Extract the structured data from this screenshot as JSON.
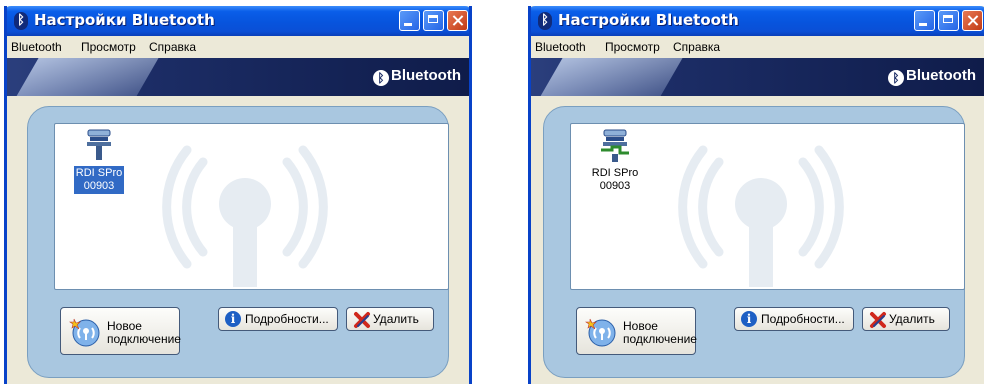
{
  "colors": {
    "title_bar": "#0754dd",
    "banner": "#1c2d66",
    "panel": "#a9c7e0",
    "selection": "#316ac5"
  },
  "windows": [
    {
      "title": "Настройки Bluetooth",
      "menu": [
        "Bluetooth",
        "Просмотр",
        "Справка"
      ],
      "brand": "Bluetooth",
      "device": {
        "name": "RDI SPro",
        "id": "00903",
        "selected": true,
        "connected": false,
        "icon": "serial-port-icon"
      },
      "buttons": {
        "new_connection_line1": "Новое",
        "new_connection_line2": "подключение",
        "details": "Подробности...",
        "delete": "Удалить"
      }
    },
    {
      "title": "Настройки Bluetooth",
      "menu": [
        "Bluetooth",
        "Просмотр",
        "Справка"
      ],
      "brand": "Bluetooth",
      "device": {
        "name": "RDI SPro",
        "id": "00903",
        "selected": false,
        "connected": true,
        "icon": "serial-port-connected-icon"
      },
      "buttons": {
        "new_connection_line1": "Новое",
        "new_connection_line2": "подключение",
        "details": "Подробности...",
        "delete": "Удалить"
      }
    }
  ]
}
